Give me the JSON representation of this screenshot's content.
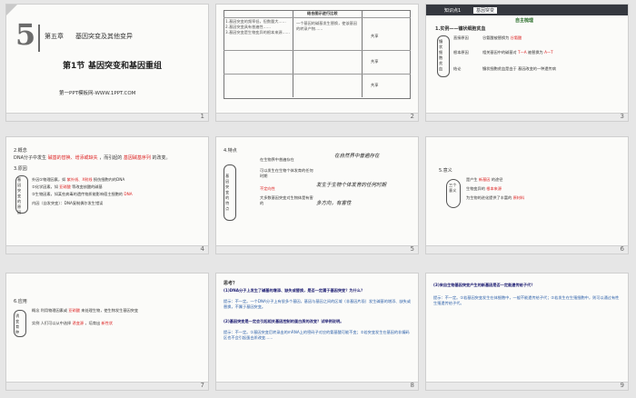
{
  "slides": [
    {
      "num": "1",
      "big": "5",
      "chapter": "第五章",
      "chapter_title": "基因突变及其他变异",
      "section": "第1节",
      "section_title": "基因突变和基因重组",
      "footer": "第一PPT模板网-WWW.1PPT.COM"
    },
    {
      "num": "2",
      "col_mid": "结合图示进行比较",
      "vals": [
        "共享",
        "共享",
        "共享"
      ]
    },
    {
      "num": "3",
      "tag": "知识点1",
      "tag2": "基因突变",
      "heading": "自主梳理",
      "item": "1.实例——镰状细胞贫血",
      "labels": [
        "镰状细胞贫血",
        "直接原因",
        "根本原因",
        "结论"
      ],
      "red1": "谷氨酸",
      "red2": "T—A",
      "red3": "A—T",
      "conclusion": "基因改变的一种遗传病"
    },
    {
      "num": "4",
      "p1": "2.概念",
      "p2_prefix": "DNA分子中发生",
      "p2_red": "碱基的替换、增添或缺失",
      "p2_mid": "，而引起的",
      "p2_red2": "基因碱基序列",
      "p2_end": "的改变。",
      "p3": "3.原因",
      "tree": "基因突变的原因",
      "reason1_red": "紫外线、X射线",
      "reason2_red": "亚硝酸",
      "reason3_red": "DNA"
    },
    {
      "num": "5",
      "p1": "4.特点",
      "mind": "基因突变的特点",
      "hand1": "在自然界中普遍存在",
      "hand2": "发生于生物个体发育的任何时期",
      "hand3": "多方向，有害性",
      "tag_red": "不定向性"
    },
    {
      "num": "6",
      "p1": "5.意义",
      "mind": "三个意义",
      "v1_red": "新基因",
      "v2_red": "根本来源",
      "v3_red": "原材料"
    },
    {
      "num": "7",
      "p1": "6.应用",
      "mind": "诱变育种",
      "red1": "亚硝酸",
      "red2": "诱变源",
      "red3": "新性状"
    },
    {
      "num": "8",
      "q_title": "思考？",
      "q1": "(1)DNA分子上发生了碱基的增添、缺失或替换，是否一定属于基因突变？为什么？",
      "q2": "(2)基因突变是一定会引起相关基因控制的蛋白质的改变？试举例说明。"
    },
    {
      "num": "9",
      "q1": "(3)来自生物基因突变产生的新基因是否一定能遗传给子代？"
    }
  ]
}
